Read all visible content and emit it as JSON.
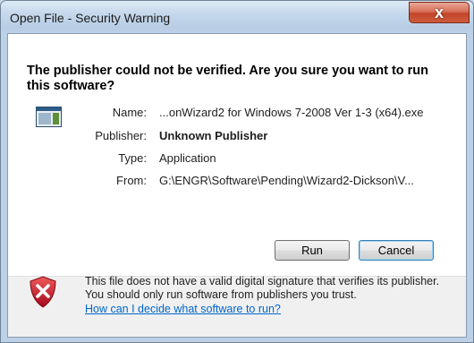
{
  "window": {
    "title": "Open File - Security Warning",
    "close_glyph": "x"
  },
  "question": "The publisher could not be verified.  Are you sure you want to run this software?",
  "file_info": [
    {
      "label": "Name:",
      "value": "...onWizard2 for Windows 7-2008 Ver 1-3 (x64).exe",
      "bold": false
    },
    {
      "label": "Publisher:",
      "value": "Unknown Publisher",
      "bold": true
    },
    {
      "label": "Type:",
      "value": "Application",
      "bold": false
    },
    {
      "label": "From:",
      "value": "G:\\ENGR\\Software\\Pending\\Wizard2-Dickson\\V...",
      "bold": false
    }
  ],
  "buttons": {
    "run": "Run",
    "cancel": "Cancel"
  },
  "footer": {
    "warning_text": "This file does not have a valid digital signature that verifies its publisher.  You should only run software from publishers you trust.",
    "help_link": "How can I decide what software to run?"
  },
  "icons": {
    "app": "application-icon",
    "warning": "shield-x-icon"
  },
  "colors": {
    "link": "#0066cc",
    "close_button": "#c2452a",
    "shield": "#c8102e"
  }
}
